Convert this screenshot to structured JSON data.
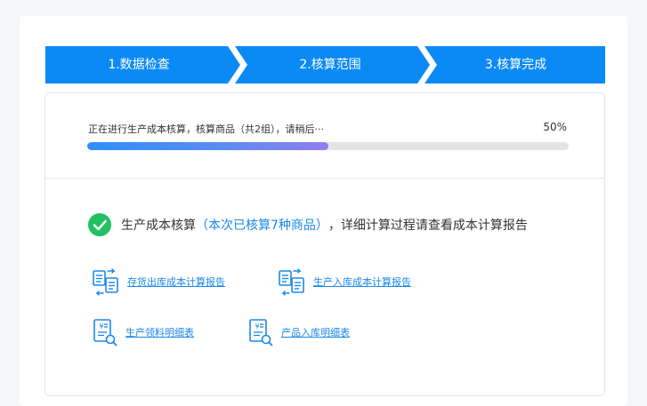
{
  "steps": [
    {
      "label": "1.数据检查"
    },
    {
      "label": "2.核算范围"
    },
    {
      "label": "3.核算完成"
    }
  ],
  "progress": {
    "message": "正在进行生产成本核算，核算商品（共2组），请稍后···",
    "percent_label": "50%",
    "percent": 50
  },
  "result": {
    "prefix": "生产成本核算",
    "highlight": "（本次已核算7种商品）",
    "suffix": "，详细计算过程请查看成本计算报告"
  },
  "links": [
    {
      "label": "存货出库成本计算报告",
      "icon": "report-transfer-icon"
    },
    {
      "label": "生产入库成本计算报告",
      "icon": "report-transfer-icon"
    },
    {
      "label": "生产领料明细表",
      "icon": "ledger-search-icon"
    },
    {
      "label": "产品入库明细表",
      "icon": "ledger-search-icon"
    }
  ],
  "colors": {
    "step_blue": "#0b8af5",
    "link_blue": "#1a88e8",
    "success_green": "#21c061"
  }
}
